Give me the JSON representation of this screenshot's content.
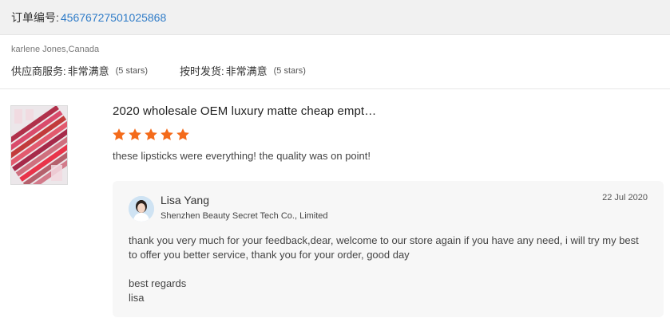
{
  "order": {
    "label": "订单编号:",
    "number": "45676727501025868"
  },
  "buyer": {
    "name": "karlene Jones,Canada",
    "supplier_service_label": "供应商服务:",
    "supplier_service_value": "非常满意",
    "supplier_service_stars": "(5 stars)",
    "delivery_label": "按时发货:",
    "delivery_value": "非常满意",
    "delivery_stars": "(5 stars)"
  },
  "review": {
    "product_title": "2020 wholesale OEM luxury matte cheap empt…",
    "rating": 5,
    "star_color": "#f46b1b",
    "text": "these lipsticks were everything! the quality was on point!"
  },
  "reply": {
    "seller_name": "Lisa Yang",
    "company": "Shenzhen Beauty Secret Tech Co., Limited",
    "date": "22 Jul 2020",
    "body": "thank you very much for your feedback,dear, welcome to our store again if you have any need, i will try my best to offer you better service, thank you for your order, good day",
    "regards_line1": "best regards",
    "regards_line2": "lisa"
  },
  "colors": {
    "link": "#2f7cc8",
    "header_bg": "#f1f1f1",
    "reply_bg": "#f7f7f7"
  },
  "icons": {
    "star": "star-icon",
    "avatar": "seller-avatar",
    "product": "lipstick-product-thumbnail"
  }
}
